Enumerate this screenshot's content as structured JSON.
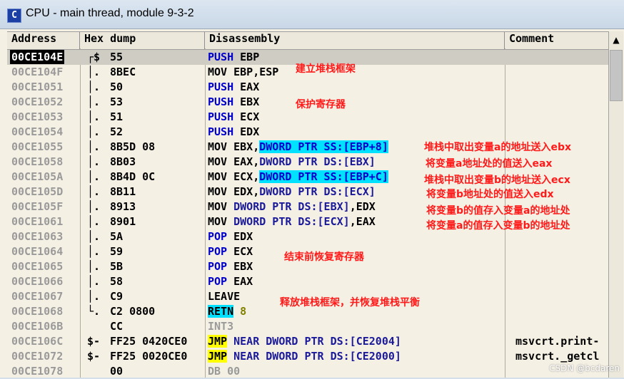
{
  "window": {
    "title": "CPU - main thread, module 9-3-2",
    "icon_letter": "C"
  },
  "columns": {
    "address": "Address",
    "hex": "Hex dump",
    "disasm": "Disassembly",
    "comment": "Comment"
  },
  "rows": [
    {
      "addr": "00CE104E",
      "mark": "┌$",
      "hex": "55",
      "mnem": "PUSH",
      "ops": "EBP"
    },
    {
      "addr": "00CE104F",
      "mark": "│.",
      "hex": "8BEC",
      "mnem": "MOV",
      "ops": "EBP,ESP"
    },
    {
      "addr": "00CE1051",
      "mark": "│.",
      "hex": "50",
      "mnem": "PUSH",
      "ops": "EAX"
    },
    {
      "addr": "00CE1052",
      "mark": "│.",
      "hex": "53",
      "mnem": "PUSH",
      "ops": "EBX"
    },
    {
      "addr": "00CE1053",
      "mark": "│.",
      "hex": "51",
      "mnem": "PUSH",
      "ops": "ECX"
    },
    {
      "addr": "00CE1054",
      "mark": "│.",
      "hex": "52",
      "mnem": "PUSH",
      "ops": "EDX"
    },
    {
      "addr": "00CE1055",
      "mark": "│.",
      "hex": "8B5D 08",
      "mnem": "MOV",
      "ops_a": "EBX,",
      "ops_b": "DWORD PTR SS:[EBP+8]"
    },
    {
      "addr": "00CE1058",
      "mark": "│.",
      "hex": "8B03",
      "mnem": "MOV",
      "ops_a": "EAX,",
      "ops_b": "DWORD PTR DS:[EBX]"
    },
    {
      "addr": "00CE105A",
      "mark": "│.",
      "hex": "8B4D 0C",
      "mnem": "MOV",
      "ops_a": "ECX,",
      "ops_b": "DWORD PTR SS:[EBP+C]"
    },
    {
      "addr": "00CE105D",
      "mark": "│.",
      "hex": "8B11",
      "mnem": "MOV",
      "ops_a": "EDX,",
      "ops_b": "DWORD PTR DS:[ECX]"
    },
    {
      "addr": "00CE105F",
      "mark": "│.",
      "hex": "8913",
      "mnem": "MOV",
      "ops_a": "DWORD PTR DS:[EBX]",
      "ops_b": ",EDX"
    },
    {
      "addr": "00CE1061",
      "mark": "│.",
      "hex": "8901",
      "mnem": "MOV",
      "ops_a": "DWORD PTR DS:[ECX]",
      "ops_b": ",EAX"
    },
    {
      "addr": "00CE1063",
      "mark": "│.",
      "hex": "5A",
      "mnem": "POP",
      "ops": "EDX"
    },
    {
      "addr": "00CE1064",
      "mark": "│.",
      "hex": "59",
      "mnem": "POP",
      "ops": "ECX"
    },
    {
      "addr": "00CE1065",
      "mark": "│.",
      "hex": "5B",
      "mnem": "POP",
      "ops": "EBX"
    },
    {
      "addr": "00CE1066",
      "mark": "│.",
      "hex": "58",
      "mnem": "POP",
      "ops": "EAX"
    },
    {
      "addr": "00CE1067",
      "mark": "│.",
      "hex": "C9",
      "mnem": "LEAVE",
      "ops": ""
    },
    {
      "addr": "00CE1068",
      "mark": "└.",
      "hex": "C2 0800",
      "mnem": "RETN",
      "ops": "8"
    },
    {
      "addr": "00CE106B",
      "mark": "",
      "hex": "CC",
      "mnem": "INT3",
      "ops": ""
    },
    {
      "addr": "00CE106C",
      "mark": "$-",
      "hex": "FF25 0420CE0",
      "mnem": "JMP",
      "ops": "NEAR DWORD PTR DS:[CE2004]",
      "comment": "msvcrt.print-"
    },
    {
      "addr": "00CE1072",
      "mark": "$-",
      "hex": "FF25 0020CE0",
      "mnem": "JMP",
      "ops": "NEAR DWORD PTR DS:[CE2000]",
      "comment": "msvcrt._getcl"
    },
    {
      "addr": "00CE1078",
      "mark": "",
      "hex": "00",
      "mnem": "DB",
      "ops": "00"
    }
  ],
  "annotations": {
    "n1": "建立堆栈框架",
    "n2": "保护寄存器",
    "n3": "堆栈中取出变量a的地址送入ebx",
    "n4": "将变量a地址处的值送入eax",
    "n5": "堆栈中取出变量b的地址送入ecx",
    "n6": "将变量b地址处的值送入edx",
    "n7": "将变量b的值存入变量a的地址处",
    "n8": "将变量a的值存入变量b的地址处",
    "n9": "结束前恢复寄存器",
    "n10": "释放堆栈框架，并恢复堆栈平衡"
  },
  "watermark": "CSDN @bcdaren",
  "colors": {
    "mnemonic_blue": "#0000cc",
    "highlight_cyan": "#00e0ff",
    "jmp_yellow": "#ffff00",
    "note_red": "#ff1a1a"
  }
}
